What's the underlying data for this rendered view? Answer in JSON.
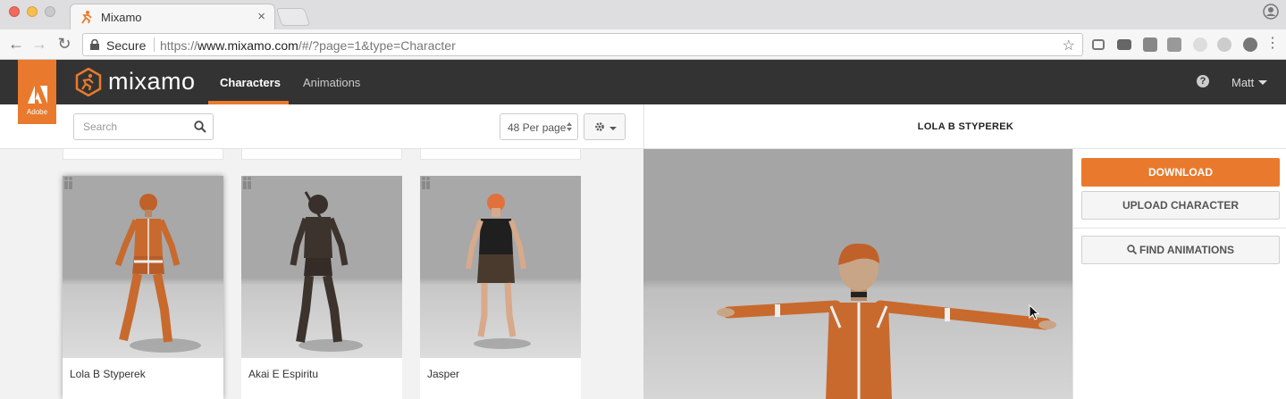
{
  "browser": {
    "tab_title": "Mixamo",
    "secure_label": "Secure",
    "url_prefix": "https://",
    "url_host": "www.mixamo.com",
    "url_path": "/#/?page=1&type=Character"
  },
  "header": {
    "adobe_label": "Adobe",
    "brand": "mixamo",
    "tabs": [
      {
        "label": "Characters",
        "active": true
      },
      {
        "label": "Animations",
        "active": false
      }
    ],
    "help_glyph": "?",
    "user_name": "Matt"
  },
  "toolbar": {
    "search_placeholder": "Search",
    "per_page": "48 Per page"
  },
  "characters": [
    {
      "name": "Lola B Styperek",
      "selected": true
    },
    {
      "name": "Akai E Espiritu",
      "selected": false
    },
    {
      "name": "Jasper",
      "selected": false
    }
  ],
  "viewer": {
    "title": "LOLA B STYPEREK"
  },
  "actions": {
    "download": "DOWNLOAD",
    "upload": "UPLOAD CHARACTER",
    "find": "FIND ANIMATIONS"
  },
  "colors": {
    "accent": "#e97a2d",
    "header_bg": "#333333"
  }
}
